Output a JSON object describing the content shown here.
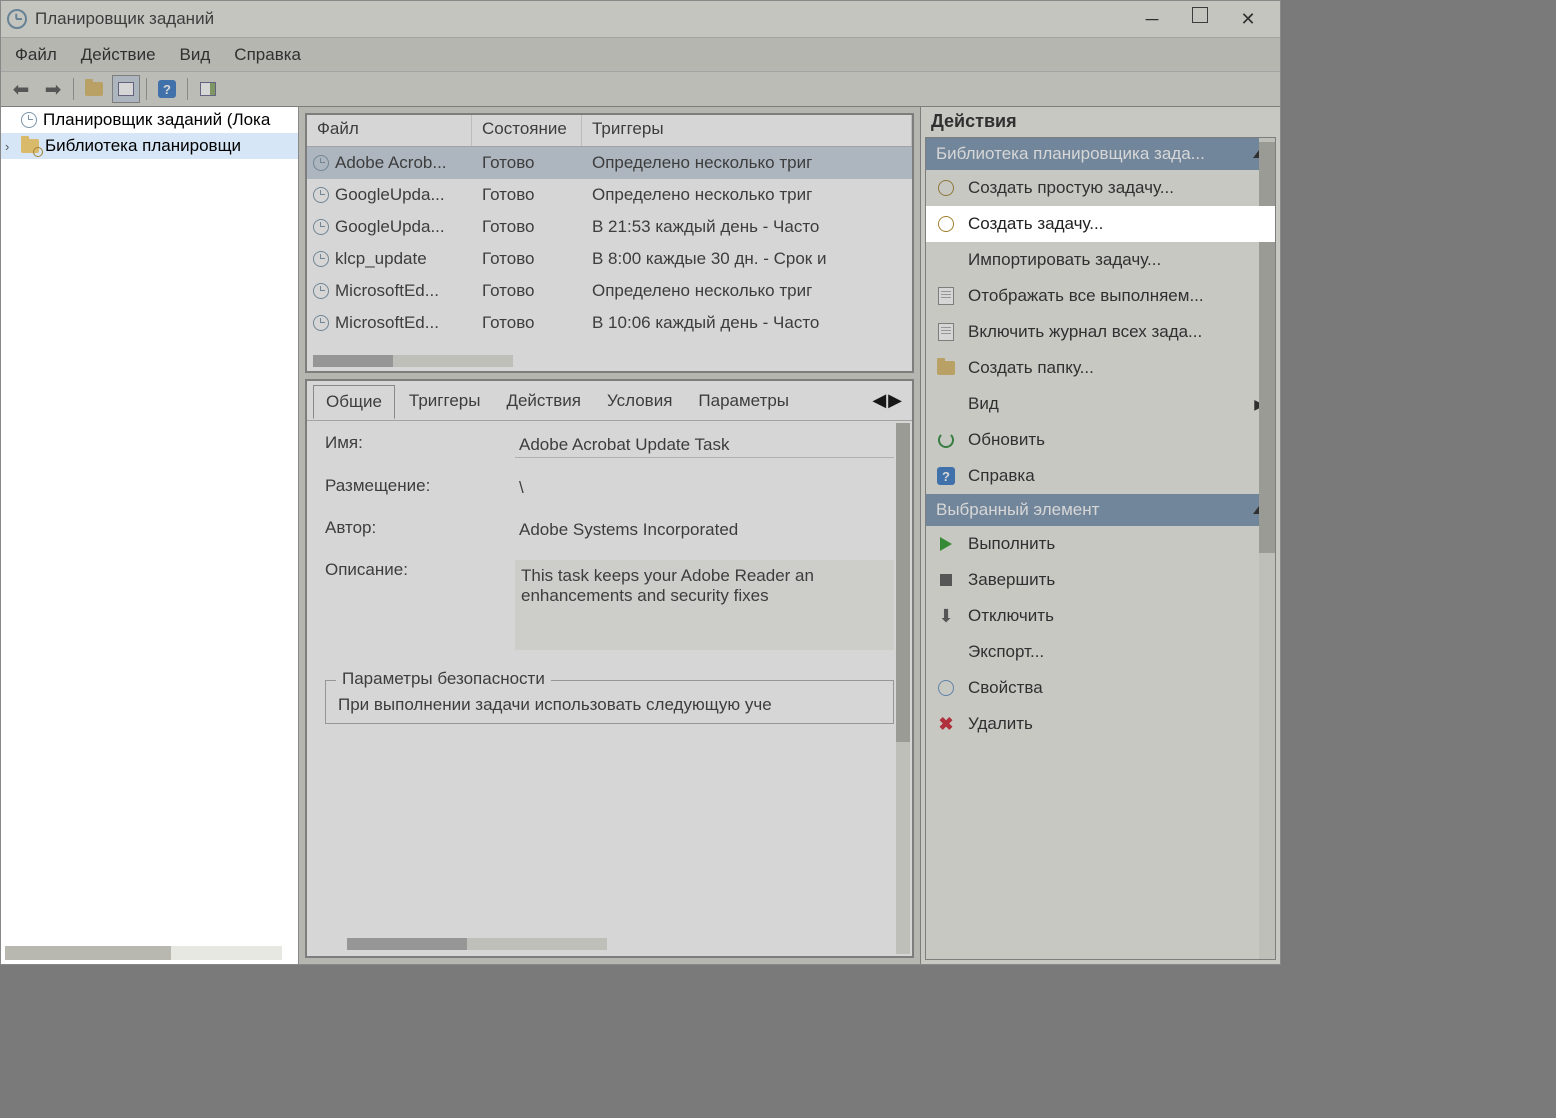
{
  "window": {
    "title": "Планировщик заданий"
  },
  "menubar": {
    "file": "Файл",
    "action": "Действие",
    "view": "Вид",
    "help": "Справка"
  },
  "tree": {
    "root": "Планировщик заданий (Лока",
    "library": "Библиотека планировщи"
  },
  "task_list": {
    "columns": {
      "file": "Файл",
      "state": "Состояние",
      "triggers": "Триггеры"
    },
    "rows": [
      {
        "name": "Adobe Acrob...",
        "state": "Готово",
        "trigger": "Определено несколько триг",
        "selected": true
      },
      {
        "name": "GoogleUpda...",
        "state": "Готово",
        "trigger": "Определено несколько триг"
      },
      {
        "name": "GoogleUpda...",
        "state": "Готово",
        "trigger": "В 21:53 каждый день - Часто"
      },
      {
        "name": "klcp_update",
        "state": "Готово",
        "trigger": "В 8:00 каждые 30 дн. - Срок и"
      },
      {
        "name": "MicrosoftEd...",
        "state": "Готово",
        "trigger": "Определено несколько триг"
      },
      {
        "name": "MicrosoftEd...",
        "state": "Готово",
        "trigger": "В 10:06 каждый день - Часто"
      }
    ]
  },
  "detail": {
    "tabs": {
      "general": "Общие",
      "triggers": "Триггеры",
      "actions": "Действия",
      "conditions": "Условия",
      "settings": "Параметры"
    },
    "labels": {
      "name": "Имя:",
      "location": "Размещение:",
      "author": "Автор:",
      "description": "Описание:"
    },
    "values": {
      "name": "Adobe Acrobat Update Task",
      "location": "\\",
      "author": "Adobe Systems Incorporated",
      "description": "This task keeps your Adobe Reader an enhancements and security fixes"
    },
    "security_legend": "Параметры безопасности",
    "security_text": "При выполнении задачи использовать следующую уче"
  },
  "actions": {
    "title": "Действия",
    "lib_header": "Библиотека планировщика зада...",
    "items_lib": [
      {
        "label": "Создать простую задачу...",
        "icon": "small-clock"
      },
      {
        "label": "Создать задачу...",
        "icon": "small-clock",
        "hover": true
      },
      {
        "label": "Импортировать задачу...",
        "icon": ""
      },
      {
        "label": "Отображать все выполняем...",
        "icon": "page"
      },
      {
        "label": "Включить журнал всех зада...",
        "icon": "page"
      },
      {
        "label": "Создать папку...",
        "icon": "folder"
      },
      {
        "label": "Вид",
        "icon": "",
        "chevron": true
      },
      {
        "label": "Обновить",
        "icon": "refresh"
      },
      {
        "label": "Справка",
        "icon": "help"
      }
    ],
    "sel_header": "Выбранный элемент",
    "items_sel": [
      {
        "label": "Выполнить",
        "icon": "play"
      },
      {
        "label": "Завершить",
        "icon": "stop"
      },
      {
        "label": "Отключить",
        "icon": "down"
      },
      {
        "label": "Экспорт...",
        "icon": ""
      },
      {
        "label": "Свойства",
        "icon": "small-clock blue"
      },
      {
        "label": "Удалить",
        "icon": "x"
      }
    ]
  }
}
